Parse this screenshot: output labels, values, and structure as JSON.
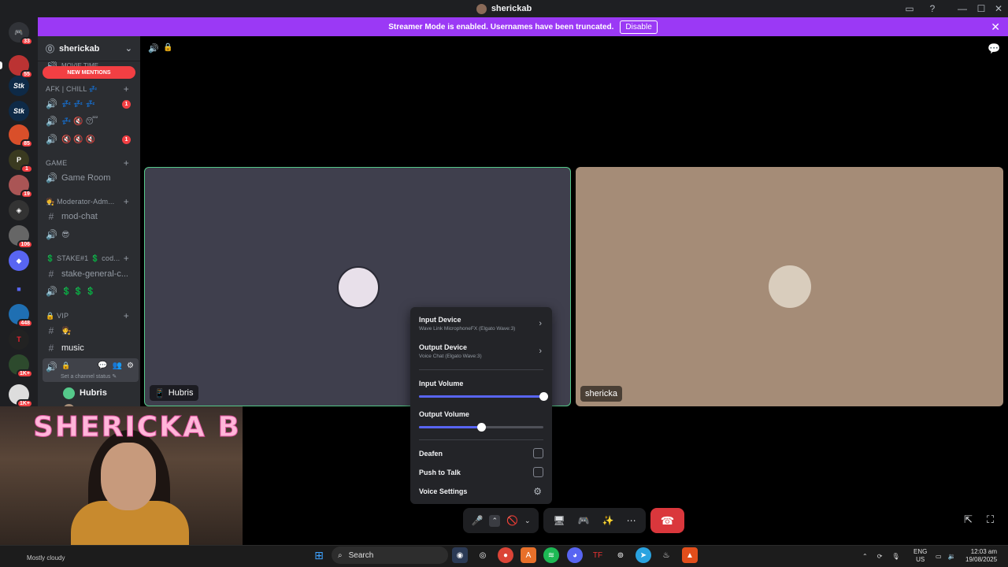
{
  "window": {
    "title": "sherickab",
    "minimize": "—",
    "maximize": "☐",
    "close": "✕"
  },
  "banner": {
    "text": "Streamer Mode is enabled. Usernames have been truncated.",
    "button": "Disable",
    "close": "✕"
  },
  "server_rail": {
    "badges": [
      "33",
      "55",
      "85",
      "1",
      "19",
      "106",
      "448",
      "1K+",
      "1K+"
    ]
  },
  "sidebar": {
    "server_name": "sherickab",
    "new_mentions": "NEW MENTIONS",
    "truncated_channel": "MOVIE TIME",
    "categories": {
      "afk": "AFK | CHILL 💤",
      "game": "GAME",
      "moderator": "🧑‍⚖️ Moderator-Adm...",
      "stake": "💲 STAKE#1 💲 cod...",
      "vip": "🔒 VIP"
    },
    "channels": {
      "afk1": "💤 💤 💤",
      "afk2": "💤 🔇 😴",
      "afk3": "🔇 🔇 🔇",
      "game_room": "Game Room",
      "mod_chat": "mod-chat",
      "mod_voice": "😎",
      "stake_general": "stake-general-c...",
      "stake_voice": "💲 💲 💲",
      "vip_text": "🧑‍⚖️",
      "music": "music"
    },
    "unread_counts": {
      "afk1": "1",
      "afk3": "1"
    },
    "channel_status": "Set a channel status ✎",
    "voice_users": [
      "Hubris",
      "shericka"
    ]
  },
  "stage": {
    "tiles": [
      {
        "name": "Hubris",
        "device": "📱"
      },
      {
        "name": "shericka",
        "device": ""
      }
    ]
  },
  "audio_popup": {
    "input_device_label": "Input Device",
    "input_device_value": "Wave Link MicrophoneFX (Elgato Wave:3)",
    "output_device_label": "Output Device",
    "output_device_value": "Voice Chat (Elgato Wave:3)",
    "input_volume_label": "Input Volume",
    "input_volume": 1.0,
    "output_volume_label": "Output Volume",
    "output_volume": 0.5,
    "deafen_label": "Deafen",
    "deafen": false,
    "ptt_label": "Push to Talk",
    "ptt": false,
    "voice_settings_label": "Voice Settings"
  },
  "overlay": {
    "name": "SHERICKA B"
  },
  "taskbar": {
    "weather": "Mostly cloudy",
    "search_placeholder": "Search",
    "lang": "ENG",
    "region": "US",
    "time": "12:03 am",
    "date": "19/08/2025"
  },
  "colors": {
    "accent": "#5865f2",
    "banner": "#9b39f5",
    "danger": "#da373c",
    "speaking": "#55c98a"
  }
}
